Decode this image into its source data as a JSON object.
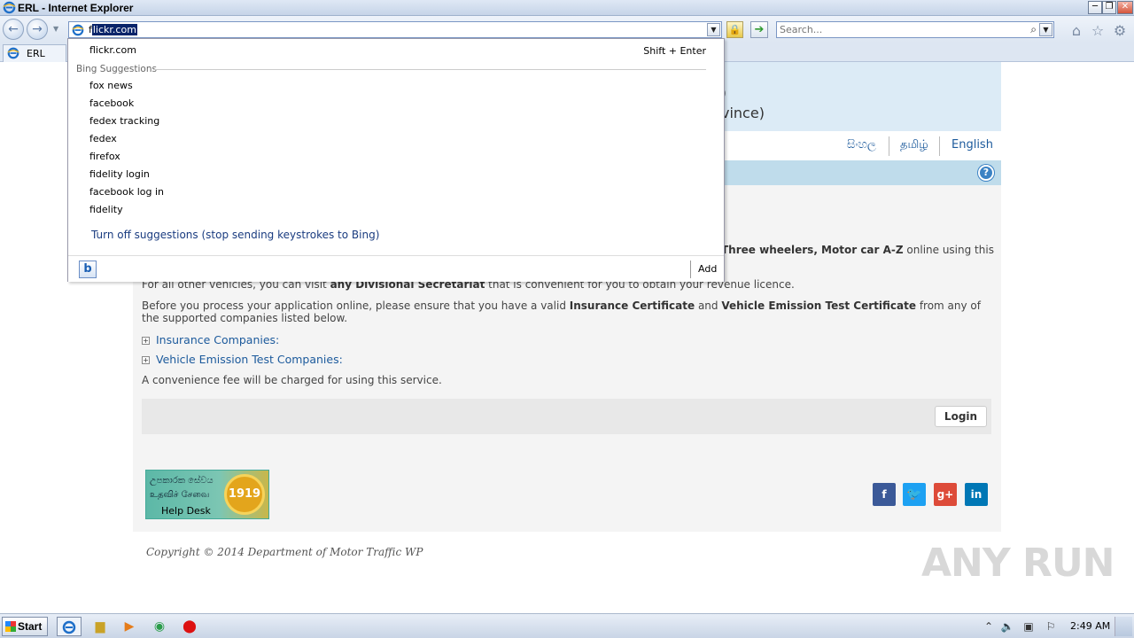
{
  "window": {
    "title": "ERL - Internet Explorer",
    "min_label": "─",
    "max_label": "❐",
    "close_label": "✕"
  },
  "nav": {
    "back_glyph": "←",
    "forward_glyph": "→",
    "address_typed": "f",
    "address_completion": "lickr.com",
    "search_placeholder": "Search..."
  },
  "tabs": [
    {
      "label": "ERL"
    }
  ],
  "autocomplete": {
    "top_entry": "flickr.com",
    "top_shortcut": "Shift + Enter",
    "group_label": "Bing Suggestions",
    "suggestions": [
      "fox news",
      "facebook",
      "fedex tracking",
      "fedex",
      "firefox",
      "fidelity login",
      "facebook log in",
      "fidelity"
    ],
    "turn_off": "Turn off suggestions (stop sending keystrokes to Bing)",
    "add_label": "Add"
  },
  "page": {
    "banner_line1": ")",
    "banner_line2": "vince)",
    "languages": [
      "සිංහල",
      "தமிழ்",
      "English"
    ],
    "intro_bold": "Three wheelers, Motor car A-Z",
    "intro_tail": " online using this",
    "p2_lead": "For all other vehicles, you can visit ",
    "p2_bold": "any Divisional Secretariat",
    "p2_tail": " that is convenient for you to obtain your revenue licence.",
    "p3_lead": "Before you process your application online, please ensure that you have a valid ",
    "p3_bold1": "Insurance Certificate",
    "p3_mid": " and ",
    "p3_bold2": "Vehicle Emission Test Certificate",
    "p3_tail": " from any of the supported companies listed below.",
    "expander1": "Insurance Companies:",
    "expander2": "Vehicle Emission Test Companies:",
    "fee_note": "A convenience fee will be charged for using this service.",
    "login_label": "Login",
    "helpdesk_line1": "උපකාරක සේවය",
    "helpdesk_line2": "உதவிச் சேவை",
    "helpdesk_line3": "Help Desk",
    "helpdesk_number": "1919",
    "copyright": "Copyright © 2014 Department of Motor Traffic WP",
    "watermark": "ANY RUN"
  },
  "taskbar": {
    "start_label": "Start",
    "clock": "2:49 AM"
  },
  "colors": {
    "link": "#1c5a9c",
    "banner": "#dcebf6",
    "bluebar": "#bfdceb"
  }
}
